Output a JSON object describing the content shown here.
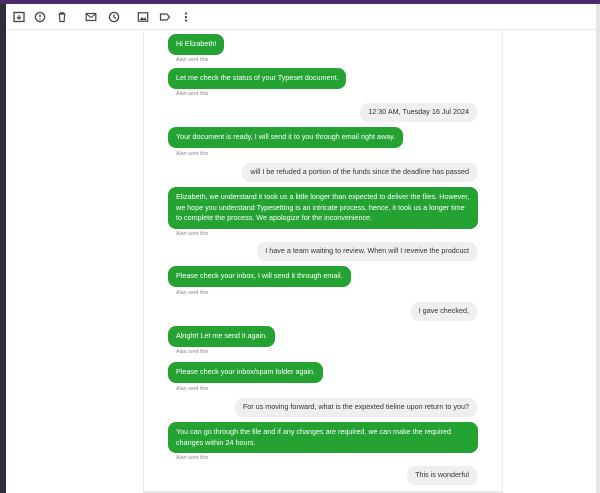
{
  "toolbar": {
    "icons": [
      "archive-icon",
      "clock-alert-icon",
      "trash-icon",
      "mail-icon",
      "clock-icon",
      "image-icon",
      "label-icon",
      "more-vert-icon"
    ]
  },
  "conversation": {
    "sent_caption": "Alan sent this",
    "messages": [
      {
        "from": "agent",
        "text": "Hi Elizabeth!",
        "caption": "Alan sent this"
      },
      {
        "from": "agent",
        "text": "Let me check the status of your Typeset document.",
        "caption": "Alan sent this"
      },
      {
        "from": "user",
        "text": "12:30 AM, Tuesday 16 Jul 2024"
      },
      {
        "from": "agent",
        "text": "Your document is ready, I will send it to you through email right away.",
        "caption": "Alan sent this"
      },
      {
        "from": "user",
        "text": "will I be refuded a portion of the funds since the deadline has passed"
      },
      {
        "from": "agent",
        "text": "Elizabeth, we understand it took us a little longer than expected to deliver the files. However, we hope you understand Typesetting is an intricate process, hence, it took us a longer time to complete the process. We apologize for the inconvenience.",
        "caption": "Alan sent this"
      },
      {
        "from": "user",
        "text": "I have a team waiting to review. When will I reveive the prodcuct"
      },
      {
        "from": "agent",
        "text": "Please check your inbox, I will send it through email.",
        "caption": "Alan sent this"
      },
      {
        "from": "user",
        "text": "I gave checked,"
      },
      {
        "from": "agent",
        "text": "Alright! Let me send it again.",
        "caption": "Alan sent this"
      },
      {
        "from": "agent",
        "text": "Please check your inbox/spam folder again.",
        "caption": "Alan sent this"
      },
      {
        "from": "user",
        "text": "For us moving forward, what is the expexted tieline upon return to you?"
      },
      {
        "from": "agent",
        "text": "You can go through the file and if any changes are required, we can make the required changes within 24 hours.",
        "caption": "Alan sent this"
      },
      {
        "from": "user",
        "text": "This is wonderful"
      }
    ]
  },
  "colors": {
    "agent_bubble": "#25a332",
    "user_bubble": "#efefef",
    "top_strip": "#4a2a6a"
  }
}
